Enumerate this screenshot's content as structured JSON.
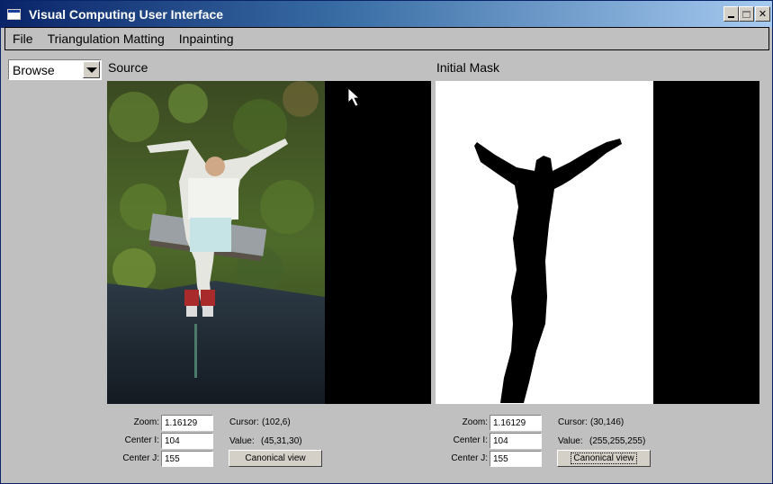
{
  "window": {
    "title": "Visual Computing User Interface"
  },
  "menu": {
    "items": [
      "File",
      "Triangulation Matting",
      "Inpainting"
    ]
  },
  "mode_select": {
    "value": "Browse"
  },
  "panes": [
    {
      "title": "Source",
      "zoom_label": "Zoom:",
      "zoom": "1.16129",
      "center_i_label": "Center I:",
      "center_i": "104",
      "center_j_label": "Center J:",
      "center_j": "155",
      "cursor_label": "Cursor:",
      "cursor": "(102,6)",
      "value_label": "Value:",
      "value": "(45,31,30)",
      "canonical_label": "Canonical view"
    },
    {
      "title": "Initial Mask",
      "zoom_label": "Zoom:",
      "zoom": "1.16129",
      "center_i_label": "Center I:",
      "center_i": "104",
      "center_j_label": "Center J:",
      "center_j": "155",
      "cursor_label": "Cursor:",
      "cursor": "(30,146)",
      "value_label": "Value:",
      "value": "(255,255,255)",
      "canonical_label": "Canonical view"
    }
  ],
  "colors": {
    "title_start": "#0a246a",
    "title_end": "#a6caf0",
    "face": "#c0c0c0"
  },
  "icons": [
    "app-window-icon",
    "minimize-icon",
    "maximize-icon",
    "close-icon",
    "dropdown-arrow-icon",
    "mouse-pointer-icon"
  ]
}
